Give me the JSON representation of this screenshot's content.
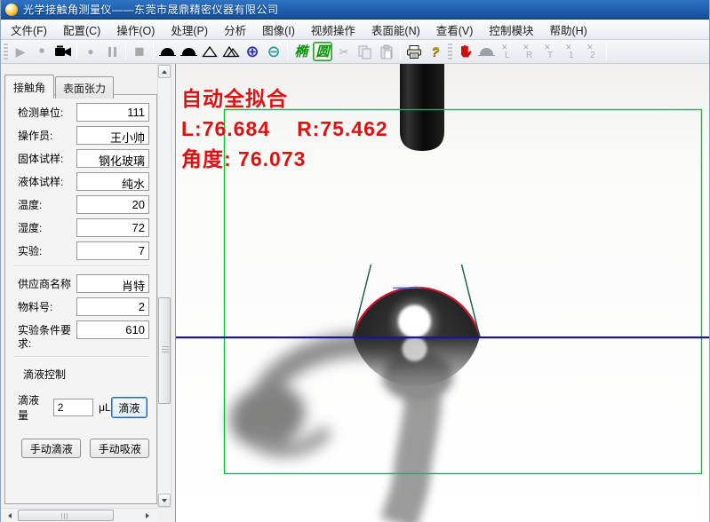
{
  "window": {
    "title": "光学接触角测量仪——东莞市晟鼎精密仪器有限公司"
  },
  "menu": {
    "items": [
      "文件(F)",
      "配置(C)",
      "操作(O)",
      "处理(P)",
      "分析",
      "图像(I)",
      "视频操作",
      "表面能(N)",
      "查看(V)",
      "控制模块",
      "帮助(H)"
    ]
  },
  "toolbar": {
    "play_glyph": "▶",
    "stop_glyph": "■",
    "record_glyph": "●",
    "snapshot_glyph": "■",
    "circle_cross_glyph": "⊕",
    "circle_minus_glyph": "⊖",
    "ellipse_fit_label": "椭",
    "circle_fit_label": "圆",
    "cut_glyph": "✂",
    "help_glyph": "?",
    "x_glyph": "✕",
    "clear_letters": {
      "left": "L",
      "right": "R",
      "top": "T",
      "one": "1",
      "two": "2"
    }
  },
  "panel": {
    "tabs": [
      {
        "label": "接触角",
        "class": "active"
      },
      {
        "label": "表面张力",
        "class": ""
      }
    ],
    "fields": [
      {
        "label": "检测单位:",
        "value": "111"
      },
      {
        "label": "操作员:",
        "value": "王小帅"
      },
      {
        "label": "固体试样:",
        "value": "钢化玻璃"
      },
      {
        "label": "液体试样:",
        "value": "纯水"
      },
      {
        "label": "温度:",
        "value": "20"
      },
      {
        "label": "湿度:",
        "value": "72"
      },
      {
        "label": "实验:",
        "value": "7"
      }
    ],
    "fields2": [
      {
        "label": "供应商名称",
        "value": "肖特"
      },
      {
        "label": "物料号:",
        "value": "2"
      },
      {
        "label": "实验条件要求:",
        "value": "610"
      }
    ],
    "drop": {
      "group_label": "滴液控制",
      "volume_label": "滴液量",
      "volume_value": "2",
      "unit": "μL",
      "drop_button": "滴液",
      "manual_drop_button": "手动滴液",
      "manual_suck_button": "手动吸液"
    }
  },
  "measurement": {
    "mode": "自动全拟合",
    "left": "L:76.684",
    "right": "R:75.462",
    "angle": "角度: 76.073"
  },
  "colors": {
    "overlay_text": "#e01113",
    "fit_curve": "#cc1433",
    "baseline": "#1717a0",
    "roi_box": "#00c832",
    "tangent_line": "#0e5b48",
    "titlebar": "#1d5cab",
    "fit_button_green": "#0a930a"
  }
}
